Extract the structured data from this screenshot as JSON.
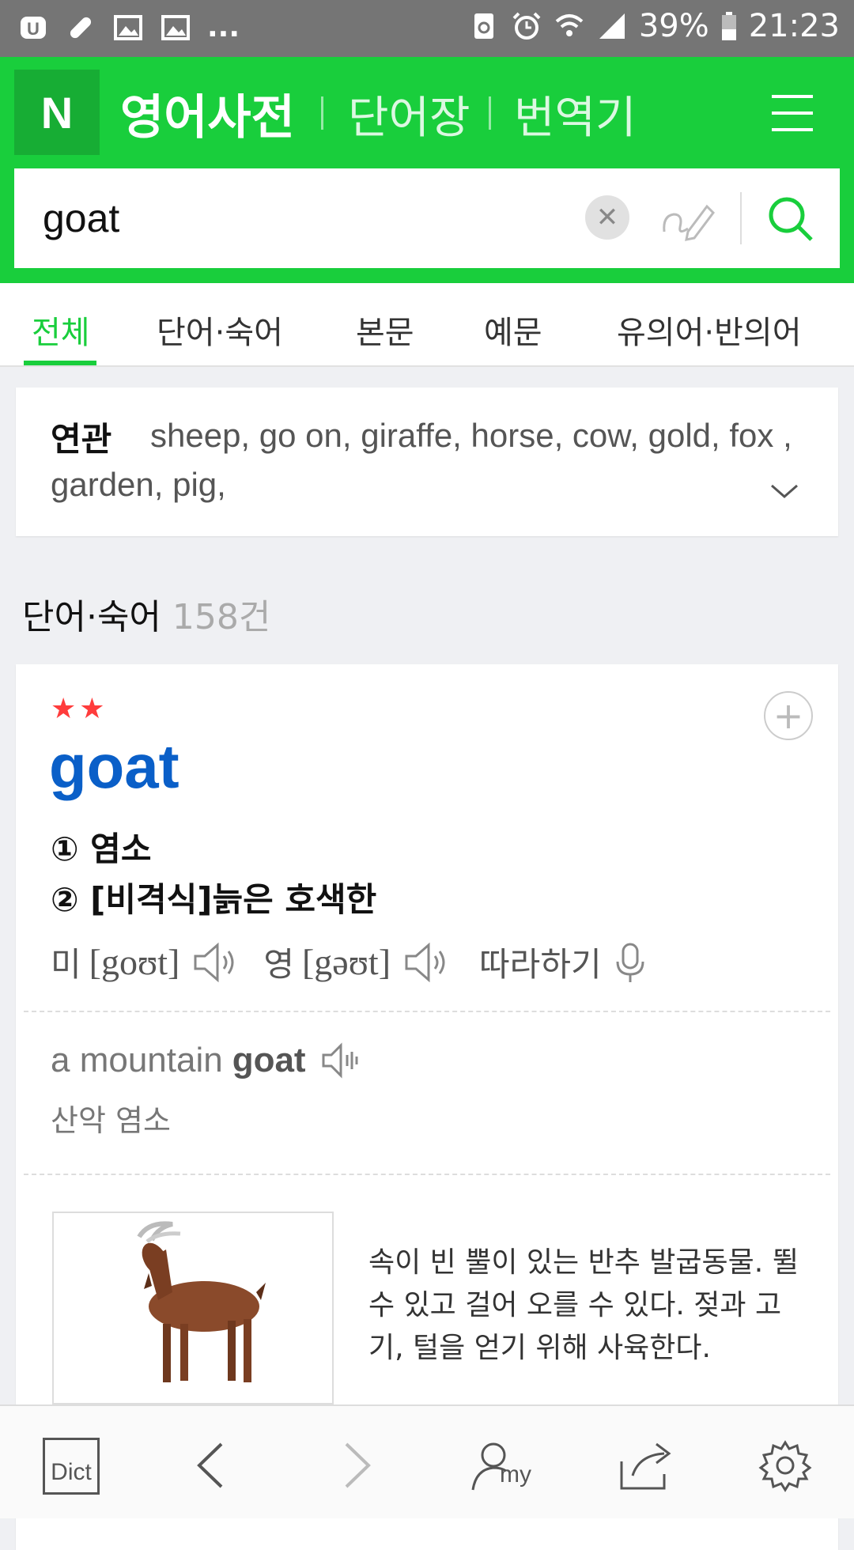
{
  "status": {
    "battery": "39%",
    "time": "21:23",
    "more": "..."
  },
  "header": {
    "logo": "N",
    "title": "영어사전",
    "links": [
      "단어장",
      "번역기"
    ]
  },
  "search": {
    "value": "goat"
  },
  "tabs": [
    "전체",
    "단어·숙어",
    "본문",
    "예문",
    "유의어·반의어"
  ],
  "related": {
    "label": "연관",
    "text": "sheep, go on, giraffe, horse, cow, gold, fox , garden, pig,"
  },
  "section": {
    "title": "단어·숙어",
    "count": "158건"
  },
  "entry": {
    "stars": "★★",
    "word": "goat",
    "meanings": [
      "① 염소",
      "② [비격식]늙은 호색한"
    ],
    "pron_us_label": "미",
    "pron_us": "[goʊt]",
    "pron_uk_label": "영",
    "pron_uk": "[gəʊt]",
    "follow": "따라하기",
    "example_prefix": "a mountain",
    "example_bold": "goat",
    "example_tr": "산악 염소",
    "description": "속이 빈 뿔이 있는 반추 발굽동물. 뛸 수 있고 걸어 오를 수 있다. 젖과 고기, 털을 얻기 위해 사육한다."
  },
  "bottom": {
    "dict_label": "Dict",
    "my_label": "my"
  },
  "colors": {
    "brand": "#19ce3c",
    "word": "#0a5fc8",
    "star": "#ff3c3c"
  }
}
